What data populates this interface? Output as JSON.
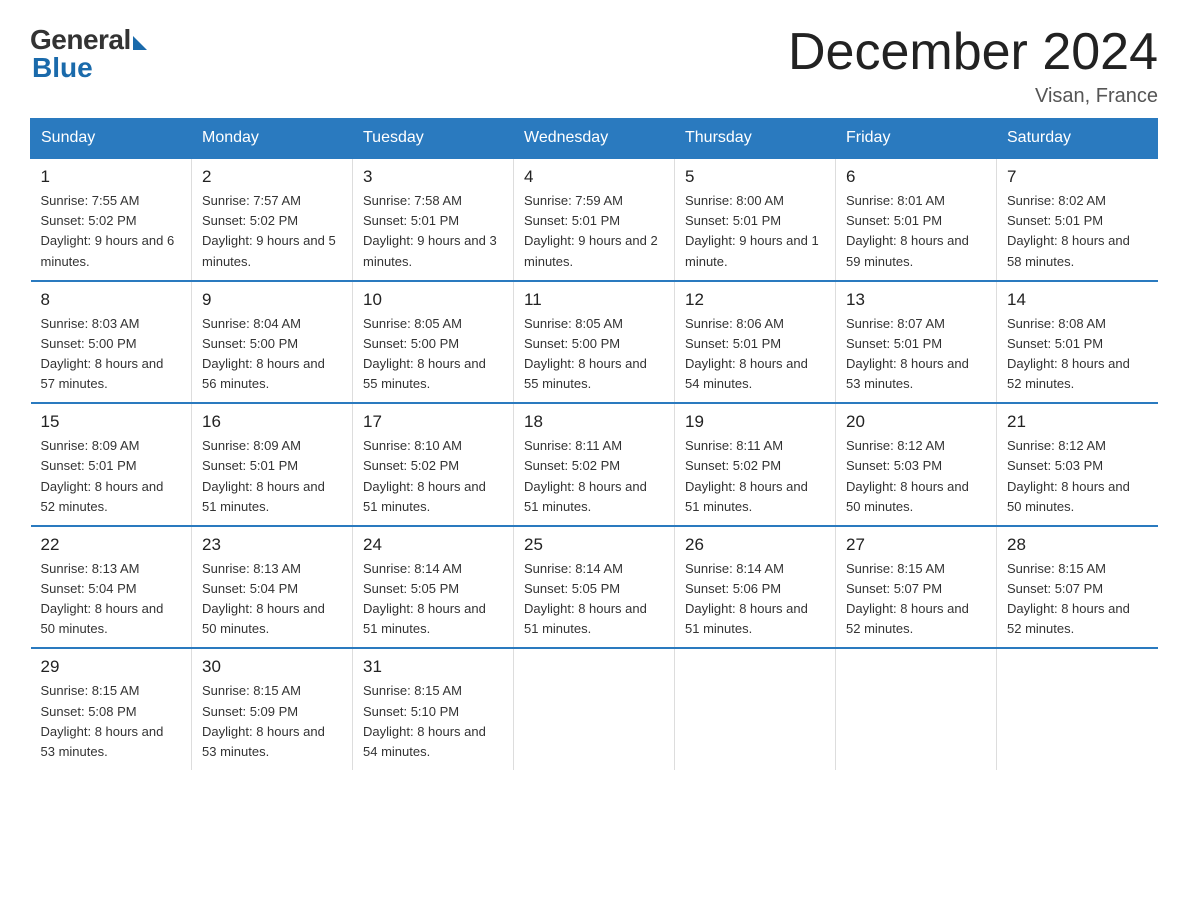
{
  "logo": {
    "general": "General",
    "blue": "Blue"
  },
  "header": {
    "month_year": "December 2024",
    "location": "Visan, France"
  },
  "days_of_week": [
    "Sunday",
    "Monday",
    "Tuesday",
    "Wednesday",
    "Thursday",
    "Friday",
    "Saturday"
  ],
  "weeks": [
    [
      {
        "day": "1",
        "sunrise": "7:55 AM",
        "sunset": "5:02 PM",
        "daylight": "9 hours and 6 minutes."
      },
      {
        "day": "2",
        "sunrise": "7:57 AM",
        "sunset": "5:02 PM",
        "daylight": "9 hours and 5 minutes."
      },
      {
        "day": "3",
        "sunrise": "7:58 AM",
        "sunset": "5:01 PM",
        "daylight": "9 hours and 3 minutes."
      },
      {
        "day": "4",
        "sunrise": "7:59 AM",
        "sunset": "5:01 PM",
        "daylight": "9 hours and 2 minutes."
      },
      {
        "day": "5",
        "sunrise": "8:00 AM",
        "sunset": "5:01 PM",
        "daylight": "9 hours and 1 minute."
      },
      {
        "day": "6",
        "sunrise": "8:01 AM",
        "sunset": "5:01 PM",
        "daylight": "8 hours and 59 minutes."
      },
      {
        "day": "7",
        "sunrise": "8:02 AM",
        "sunset": "5:01 PM",
        "daylight": "8 hours and 58 minutes."
      }
    ],
    [
      {
        "day": "8",
        "sunrise": "8:03 AM",
        "sunset": "5:00 PM",
        "daylight": "8 hours and 57 minutes."
      },
      {
        "day": "9",
        "sunrise": "8:04 AM",
        "sunset": "5:00 PM",
        "daylight": "8 hours and 56 minutes."
      },
      {
        "day": "10",
        "sunrise": "8:05 AM",
        "sunset": "5:00 PM",
        "daylight": "8 hours and 55 minutes."
      },
      {
        "day": "11",
        "sunrise": "8:05 AM",
        "sunset": "5:00 PM",
        "daylight": "8 hours and 55 minutes."
      },
      {
        "day": "12",
        "sunrise": "8:06 AM",
        "sunset": "5:01 PM",
        "daylight": "8 hours and 54 minutes."
      },
      {
        "day": "13",
        "sunrise": "8:07 AM",
        "sunset": "5:01 PM",
        "daylight": "8 hours and 53 minutes."
      },
      {
        "day": "14",
        "sunrise": "8:08 AM",
        "sunset": "5:01 PM",
        "daylight": "8 hours and 52 minutes."
      }
    ],
    [
      {
        "day": "15",
        "sunrise": "8:09 AM",
        "sunset": "5:01 PM",
        "daylight": "8 hours and 52 minutes."
      },
      {
        "day": "16",
        "sunrise": "8:09 AM",
        "sunset": "5:01 PM",
        "daylight": "8 hours and 51 minutes."
      },
      {
        "day": "17",
        "sunrise": "8:10 AM",
        "sunset": "5:02 PM",
        "daylight": "8 hours and 51 minutes."
      },
      {
        "day": "18",
        "sunrise": "8:11 AM",
        "sunset": "5:02 PM",
        "daylight": "8 hours and 51 minutes."
      },
      {
        "day": "19",
        "sunrise": "8:11 AM",
        "sunset": "5:02 PM",
        "daylight": "8 hours and 51 minutes."
      },
      {
        "day": "20",
        "sunrise": "8:12 AM",
        "sunset": "5:03 PM",
        "daylight": "8 hours and 50 minutes."
      },
      {
        "day": "21",
        "sunrise": "8:12 AM",
        "sunset": "5:03 PM",
        "daylight": "8 hours and 50 minutes."
      }
    ],
    [
      {
        "day": "22",
        "sunrise": "8:13 AM",
        "sunset": "5:04 PM",
        "daylight": "8 hours and 50 minutes."
      },
      {
        "day": "23",
        "sunrise": "8:13 AM",
        "sunset": "5:04 PM",
        "daylight": "8 hours and 50 minutes."
      },
      {
        "day": "24",
        "sunrise": "8:14 AM",
        "sunset": "5:05 PM",
        "daylight": "8 hours and 51 minutes."
      },
      {
        "day": "25",
        "sunrise": "8:14 AM",
        "sunset": "5:05 PM",
        "daylight": "8 hours and 51 minutes."
      },
      {
        "day": "26",
        "sunrise": "8:14 AM",
        "sunset": "5:06 PM",
        "daylight": "8 hours and 51 minutes."
      },
      {
        "day": "27",
        "sunrise": "8:15 AM",
        "sunset": "5:07 PM",
        "daylight": "8 hours and 52 minutes."
      },
      {
        "day": "28",
        "sunrise": "8:15 AM",
        "sunset": "5:07 PM",
        "daylight": "8 hours and 52 minutes."
      }
    ],
    [
      {
        "day": "29",
        "sunrise": "8:15 AM",
        "sunset": "5:08 PM",
        "daylight": "8 hours and 53 minutes."
      },
      {
        "day": "30",
        "sunrise": "8:15 AM",
        "sunset": "5:09 PM",
        "daylight": "8 hours and 53 minutes."
      },
      {
        "day": "31",
        "sunrise": "8:15 AM",
        "sunset": "5:10 PM",
        "daylight": "8 hours and 54 minutes."
      },
      null,
      null,
      null,
      null
    ]
  ]
}
